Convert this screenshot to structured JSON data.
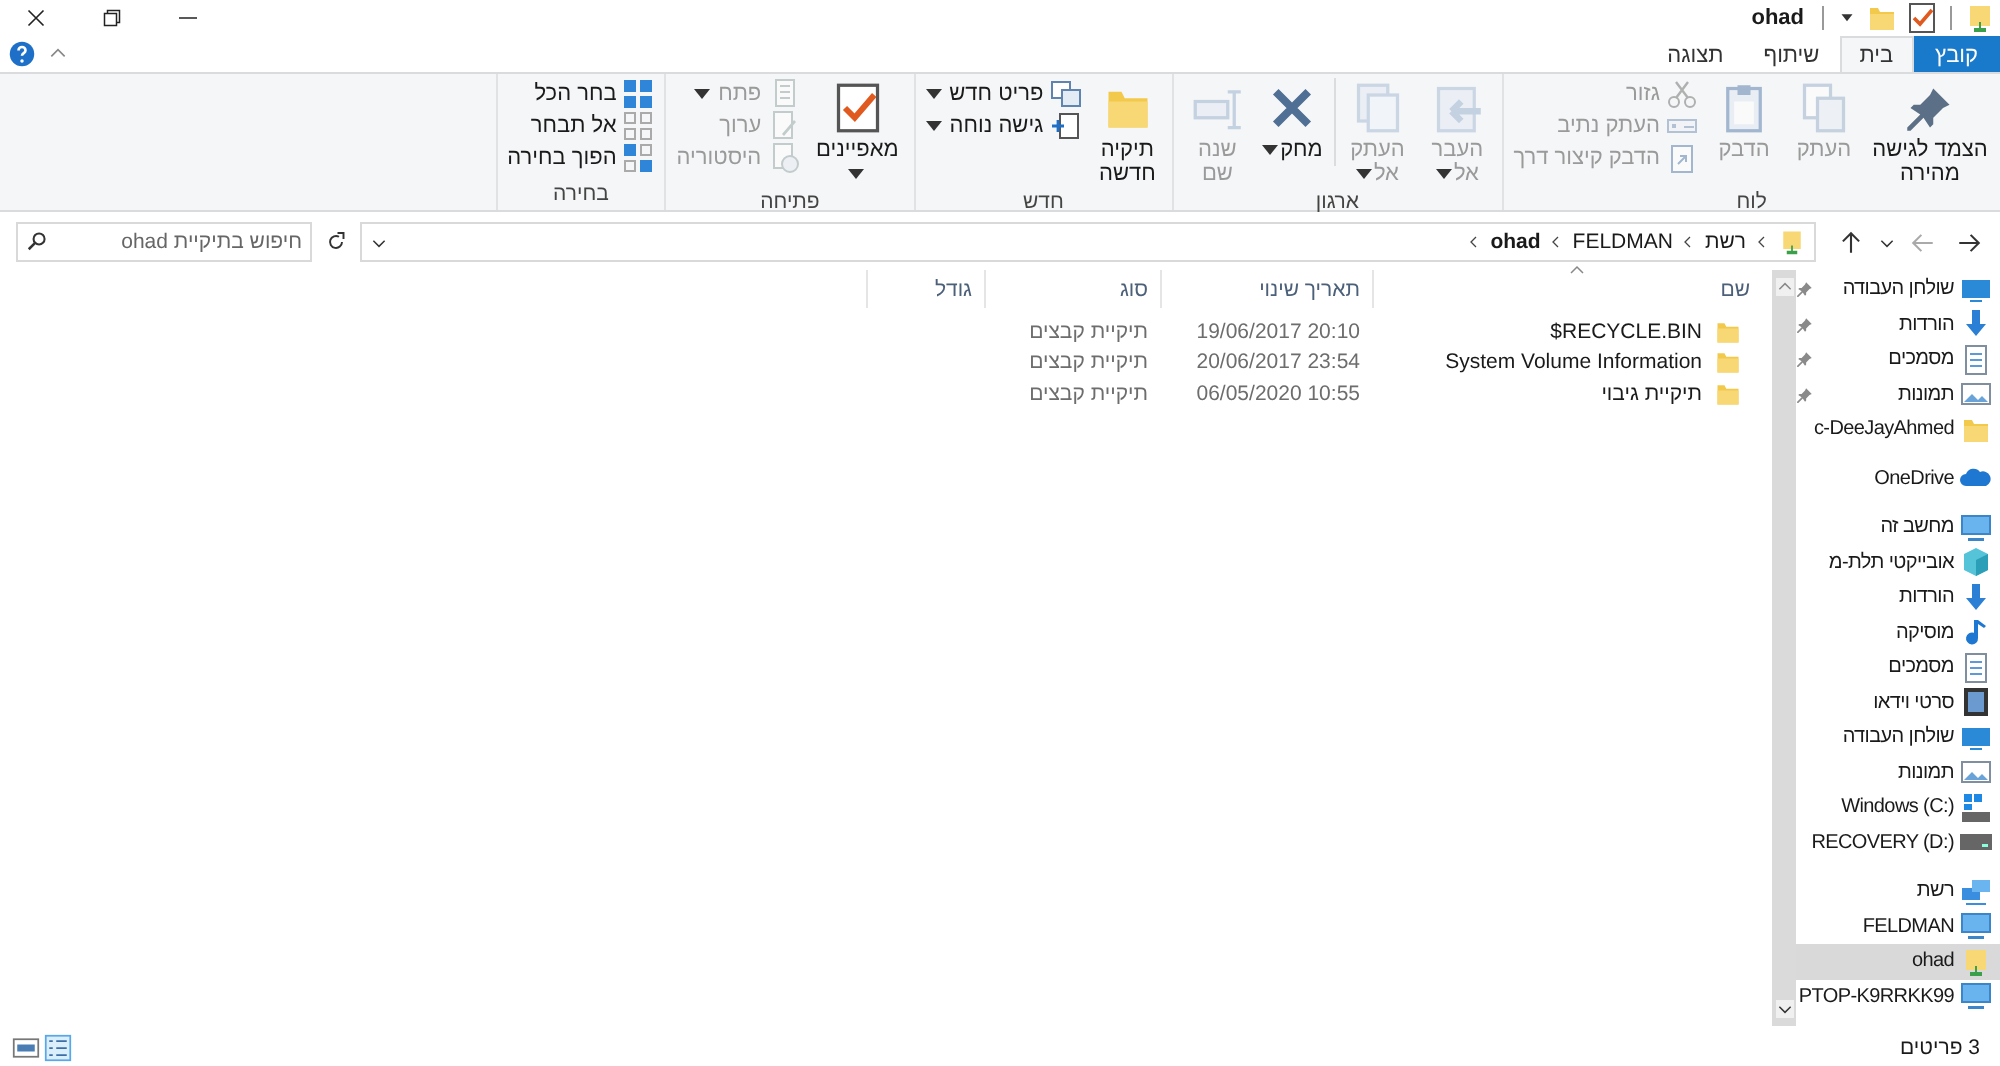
{
  "title_bar": {
    "title": "ohad"
  },
  "ribbon_tabs": [
    {
      "label": "קובץ",
      "kind": "file",
      "selected": false
    },
    {
      "label": "בית",
      "kind": "tab",
      "selected": true
    },
    {
      "label": "שיתוף",
      "kind": "tab",
      "selected": false
    },
    {
      "label": "תצוגה",
      "kind": "tab",
      "selected": false
    }
  ],
  "ribbon": {
    "groups": [
      {
        "label": "לוח",
        "items": [
          {
            "label": "הצמד לגישה מהירה",
            "kind": "large",
            "disabled": false,
            "dropdown": false
          },
          {
            "label": "העתק",
            "kind": "large",
            "disabled": true,
            "dropdown": false
          },
          {
            "label": "הדבק",
            "kind": "large",
            "disabled": true,
            "dropdown": false
          },
          {
            "label": "גזור",
            "kind": "small",
            "disabled": true,
            "dropdown": false
          },
          {
            "label": "העתק נתיב",
            "kind": "small",
            "disabled": true,
            "dropdown": false
          },
          {
            "label": "הדבק קיצור דרך",
            "kind": "small",
            "disabled": true,
            "dropdown": false
          }
        ]
      },
      {
        "label": "ארגון",
        "items": [
          {
            "label": "העבר אל",
            "kind": "large",
            "disabled": true,
            "dropdown": true
          },
          {
            "label": "העתק אל",
            "kind": "large",
            "disabled": true,
            "dropdown": true
          },
          {
            "label": "מחק",
            "kind": "large",
            "disabled": false,
            "dropdown": true
          },
          {
            "label": "שנה שם",
            "kind": "large",
            "disabled": true,
            "dropdown": false
          }
        ]
      },
      {
        "label": "חדש",
        "items": [
          {
            "label": "תיקיה חדשה",
            "kind": "large",
            "disabled": false,
            "dropdown": false
          },
          {
            "label": "פריט חדש",
            "kind": "small",
            "disabled": false,
            "dropdown": true
          },
          {
            "label": "גישה נוחה",
            "kind": "small",
            "disabled": false,
            "dropdown": true
          }
        ]
      },
      {
        "label": "פתיחה",
        "items": [
          {
            "label": "מאפיינים",
            "kind": "large",
            "disabled": false,
            "dropdown": true
          },
          {
            "label": "פתח",
            "kind": "small",
            "disabled": true,
            "dropdown": true
          },
          {
            "label": "ערוך",
            "kind": "small",
            "disabled": true,
            "dropdown": false
          },
          {
            "label": "היסטוריה",
            "kind": "small",
            "disabled": true,
            "dropdown": false
          }
        ]
      },
      {
        "label": "בחירה",
        "items": [
          {
            "label": "בחר הכל",
            "kind": "small",
            "disabled": false,
            "dropdown": false
          },
          {
            "label": "אל תבחר",
            "kind": "small",
            "disabled": false,
            "dropdown": false
          },
          {
            "label": "הפוך בחירה",
            "kind": "small",
            "disabled": false,
            "dropdown": false
          }
        ]
      }
    ]
  },
  "address_bar": {
    "breadcrumbs": [
      "רשת",
      "FELDMAN",
      "ohad"
    ]
  },
  "search": {
    "placeholder": "חיפוש בתיקיית ohad"
  },
  "nav_pane": {
    "sections": [
      {
        "items": [
          {
            "label": "שולחן העבודה",
            "pinned": true,
            "selected": false
          },
          {
            "label": "הורדות",
            "pinned": true,
            "selected": false
          },
          {
            "label": "מסמכים",
            "pinned": true,
            "selected": false
          },
          {
            "label": "תמונות",
            "pinned": true,
            "selected": false
          },
          {
            "label": "c-DeeJayAhmed",
            "pinned": false,
            "selected": false
          }
        ]
      },
      {
        "items": [
          {
            "label": "OneDrive",
            "pinned": false,
            "selected": false
          }
        ]
      },
      {
        "items": [
          {
            "label": "מחשב זה",
            "pinned": false,
            "selected": false
          },
          {
            "label": "אובייקטי תלת-מ",
            "pinned": false,
            "selected": false
          },
          {
            "label": "הורדות",
            "pinned": false,
            "selected": false
          },
          {
            "label": "מוסיקה",
            "pinned": false,
            "selected": false
          },
          {
            "label": "מסמכים",
            "pinned": false,
            "selected": false
          },
          {
            "label": "סרטי וידאו",
            "pinned": false,
            "selected": false
          },
          {
            "label": "שולחן העבודה",
            "pinned": false,
            "selected": false
          },
          {
            "label": "תמונות",
            "pinned": false,
            "selected": false
          },
          {
            "label": "Windows (C:)",
            "pinned": false,
            "selected": false
          },
          {
            "label": "RECOVERY (D:)",
            "pinned": false,
            "selected": false
          }
        ]
      },
      {
        "items": [
          {
            "label": "רשת",
            "pinned": false,
            "selected": false
          },
          {
            "label": "FELDMAN",
            "pinned": false,
            "selected": false
          },
          {
            "label": "ohad",
            "pinned": false,
            "selected": true
          },
          {
            "label": "PTOP-K9RRKK99",
            "pinned": false,
            "selected": false
          }
        ]
      }
    ]
  },
  "file_list": {
    "columns": [
      {
        "label": "שם",
        "sorted": true
      },
      {
        "label": "תאריך שינוי",
        "sorted": false
      },
      {
        "label": "סוג",
        "sorted": false
      },
      {
        "label": "גודל",
        "sorted": false
      }
    ],
    "rows": [
      {
        "name": "$RECYCLE.BIN",
        "modified": "19/06/2017 20:10",
        "type": "תיקיית קבצים"
      },
      {
        "name": "System Volume Information",
        "modified": "20/06/2017 23:54",
        "type": "תיקיית קבצים"
      },
      {
        "name": "תיקיית גיבוי",
        "modified": "06/05/2020 10:55",
        "type": "תיקיית קבצים"
      }
    ]
  },
  "status_bar": {
    "item_count": "3 פריטים"
  }
}
